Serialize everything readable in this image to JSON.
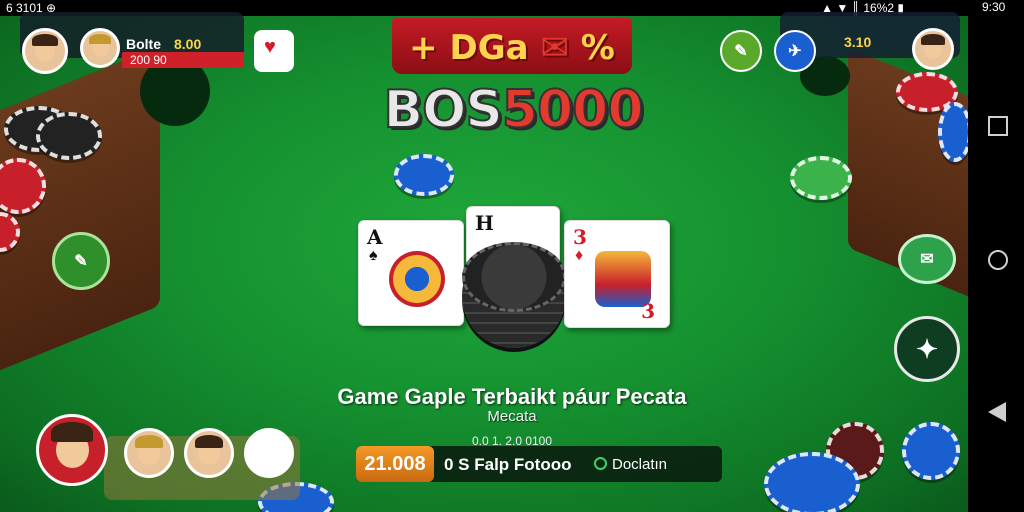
{
  "status_bar": {
    "left": "6 3101 ⊕",
    "right": "▲ ▼ ║ 16%2 ▮",
    "time": "9:30"
  },
  "top_left": {
    "player_name": "Bolte",
    "player_chips": "8.00",
    "bet_amount": "200 90"
  },
  "banner": {
    "text": "+ DGa"
  },
  "banner_suffix": "%",
  "logo": {
    "part1": "BOS",
    "part2": "5000"
  },
  "top_right": {
    "amount": "3.10"
  },
  "cards": [
    {
      "rank": "A",
      "suit": "♠"
    },
    {
      "rank": "H",
      "suit": ""
    },
    {
      "rank": "3",
      "suit": "♦",
      "rank_br": "3"
    }
  ],
  "tagline": {
    "title": "Game Gaple Terbaikt páur Pecata",
    "subtitle": "Mecata",
    "meta": "0.0 1. 2.0 0100"
  },
  "bottom_bar": {
    "amount": "21.008",
    "label": "0 S Falp Fotooo",
    "status": "Doclatın"
  },
  "colors": {
    "table_green": "#159030",
    "banner_red": "#c41b25",
    "gold": "#ffd24a",
    "orange": "#f39a28"
  },
  "icons": {
    "settings": "pencil-icon",
    "navigate": "plane-icon",
    "menu": "chip-menu-icon"
  }
}
